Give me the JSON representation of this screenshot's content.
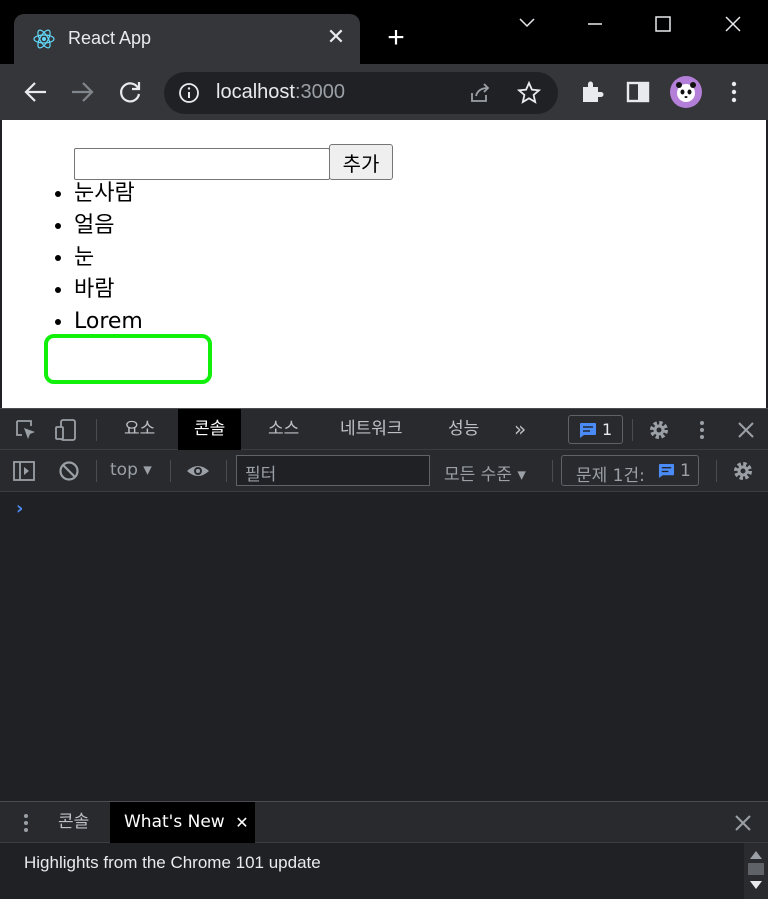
{
  "browser": {
    "tab_title": "React App",
    "url_host": "localhost",
    "url_port": ":3000"
  },
  "page": {
    "input_value": "",
    "add_button": "추가",
    "items": [
      "눈사람",
      "얼음",
      "눈",
      "바람",
      "Lorem"
    ]
  },
  "devtools": {
    "tabs": [
      "요소",
      "콘솔",
      "소스",
      "네트워크",
      "성능"
    ],
    "active_tab": "콘솔",
    "more": "»",
    "issue_badge": "1",
    "context": "top",
    "filter_placeholder": "필터",
    "levels": "모든 수준",
    "issues_label": "문제 1건:",
    "issues_count": "1"
  },
  "drawer": {
    "tabs": [
      "콘솔",
      "What's New"
    ],
    "highlights": "Highlights from the Chrome 101 update"
  },
  "colors": {
    "focus_outline": "#11f00b",
    "prompt": "#4b8bf5",
    "issue_blue": "#4b8bf5"
  }
}
